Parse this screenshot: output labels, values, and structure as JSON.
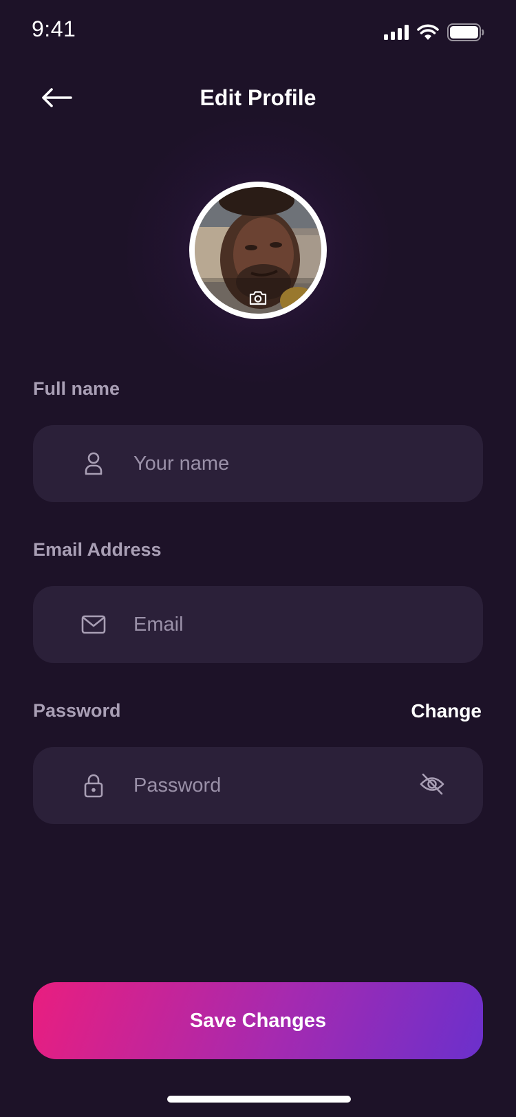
{
  "status_bar": {
    "time": "9:41",
    "icons": [
      "signal-icon",
      "wifi-icon",
      "battery-icon"
    ]
  },
  "header": {
    "title": "Edit Profile",
    "back_icon": "arrow-left-icon"
  },
  "avatar": {
    "badge_icon": "camera-icon"
  },
  "form": {
    "full_name": {
      "label": "Full name",
      "placeholder": "Your name",
      "value": "",
      "icon": "user-icon"
    },
    "email": {
      "label": "Email Address",
      "placeholder": "Email",
      "value": "",
      "icon": "mail-icon"
    },
    "password": {
      "label": "Password",
      "change_label": "Change",
      "placeholder": "Password",
      "value": "",
      "icon": "lock-icon",
      "toggle_icon": "eye-off-icon"
    }
  },
  "actions": {
    "save_label": "Save Changes"
  },
  "colors": {
    "background": "#1d1228",
    "field_background": "#2b2039",
    "label": "#a99fb5",
    "placeholder": "#9a90a8",
    "gradient_start": "#e91e7f",
    "gradient_end": "#6b30cc"
  }
}
